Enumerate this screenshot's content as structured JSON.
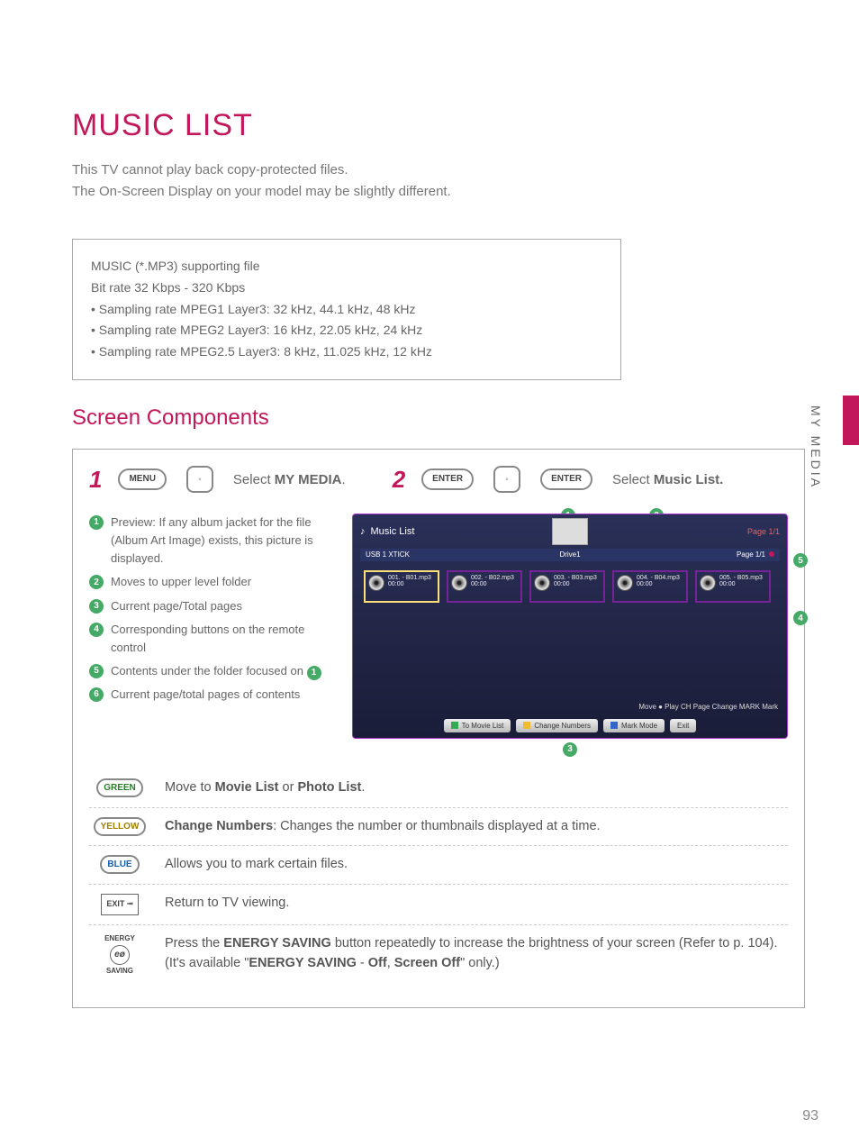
{
  "side_tab": "MY MEDIA",
  "title": "MUSIC LIST",
  "intro_l1": "This TV cannot play back copy-protected files.",
  "intro_l2": "The On-Screen Display on your model may be slightly different.",
  "support": {
    "l1": "MUSIC (*.MP3) supporting file",
    "l2": "Bit rate 32 Kbps - 320 Kbps",
    "l3": "• Sampling rate MPEG1 Layer3: 32 kHz, 44.1 kHz, 48 kHz",
    "l4": "• Sampling rate MPEG2 Layer3: 16 kHz, 22.05 kHz, 24 kHz",
    "l5": "• Sampling rate MPEG2.5 Layer3: 8 kHz, 11.025 kHz, 12 kHz"
  },
  "section_title": "Screen Components",
  "step1": {
    "num": "1",
    "btn": "MENU",
    "text_a": "Select ",
    "text_b": "MY MEDIA",
    "text_c": "."
  },
  "step2": {
    "num": "2",
    "btn": "ENTER",
    "text_a": "Select ",
    "text_b": "Music List."
  },
  "legend": {
    "i1": "Preview: If any album jacket for the file (Album Art Image) exists, this picture is displayed.",
    "i2": "Moves to upper level folder",
    "i3": "Current page/Total pages",
    "i4": "Corresponding buttons on the remote control",
    "i5": "Contents under the folder focused on ",
    "i6": "Current page/total pages of contents"
  },
  "mock": {
    "title": "Music List",
    "usb": "USB 1 XTICK",
    "page_top": "Page 1/1",
    "drive": "Drive1",
    "page_side": "Page 1/1",
    "t1a": "001. - B01.mp3",
    "t1b": "00:00",
    "t2a": "002. - B02.mp3",
    "t2b": "00:00",
    "t3a": "003. - B03.mp3",
    "t3b": "00:00",
    "t4a": "004. - B04.mp3",
    "t4b": "00:00",
    "t5a": "005. - B05.mp3",
    "t5b": "00:00",
    "hints": "Move   ● Play   CH Page Change   MARK Mark",
    "b1": "To Movie List",
    "b2": "Change Numbers",
    "b3": "Mark Mode",
    "b4": "Exit"
  },
  "controls": {
    "green_btn": "GREEN",
    "green_a": "Move to ",
    "green_b": "Movie List",
    "green_c": " or ",
    "green_d": "Photo List",
    "green_e": ".",
    "yellow_btn": "YELLOW",
    "yellow_a": "Change Numbers",
    "yellow_b": ": Changes the number or thumbnails displayed at a time.",
    "blue_btn": "BLUE",
    "blue": "Allows you to mark certain files.",
    "exit_btn": "EXIT",
    "exit": "Return to TV viewing.",
    "energy_l1": "ENERGY",
    "energy_l2": "SAVING",
    "energy_a": "Press the ",
    "energy_b": "ENERGY SAVING",
    "energy_c": " button repeatedly to increase the brightness of your screen (Refer to p. 104).",
    "energy_d": "(It's available \"",
    "energy_e": "ENERGY SAVING",
    "energy_f": " - ",
    "energy_g": "Off",
    "energy_h": ", ",
    "energy_i": "Screen Off",
    "energy_j": "\" only.)"
  },
  "page_number": "93"
}
